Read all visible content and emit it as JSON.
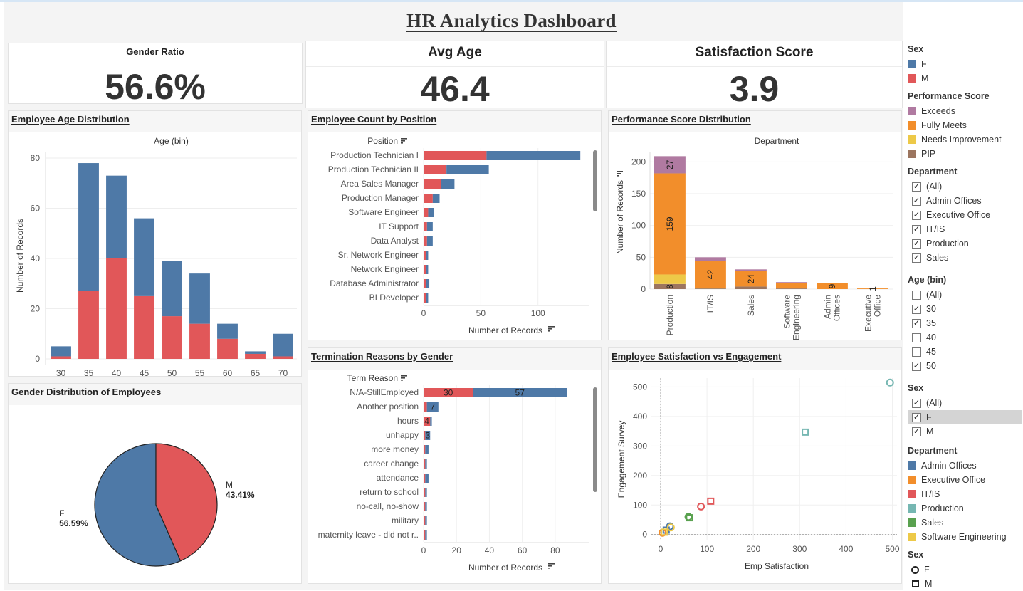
{
  "title": "HR Analytics Dashboard",
  "kpis": {
    "gender_ratio": {
      "label": "Gender Ratio",
      "value": "56.6%"
    },
    "avg_age": {
      "label": "Avg Age",
      "value": "46.4"
    },
    "satisfaction": {
      "label": "Satisfaction Score",
      "value": "3.9"
    }
  },
  "colors": {
    "F": "#4e79a7",
    "M": "#e15759",
    "Exceeds": "#b07aa1",
    "Fully Meets": "#f28e2b",
    "Needs Improvement": "#edc948",
    "PIP": "#9c755f",
    "Admin Offices": "#4e79a7",
    "Executive Office": "#f28e2b",
    "IT/IS": "#e15759",
    "Production": "#76b7b2",
    "Sales": "#59a14f",
    "Software Engineering": "#edc948"
  },
  "panels": {
    "age": {
      "title": "Employee Age Distribution",
      "header": "Age (bin)",
      "ylabel": "Number of Records"
    },
    "position": {
      "title": "Employee Count by Position",
      "header": "Position",
      "xlabel": "Number of Records"
    },
    "performance": {
      "title": "Performance Score Distribution",
      "header": "Department",
      "ylabel": "Number of Records"
    },
    "gender": {
      "title": "Gender Distribution of Employees"
    },
    "termination": {
      "title": "Termination Reasons by Gender",
      "header": "Term Reason",
      "xlabel": "Number of Records"
    },
    "satisfaction": {
      "title": "Employee Satisfaction vs Engagement",
      "xlabel": "Emp Satisfaction",
      "ylabel": "Engagement Survey"
    }
  },
  "chart_data": [
    {
      "id": "age",
      "type": "bar",
      "title": "Employee Age Distribution",
      "xlabel": "Age (bin)",
      "ylabel": "Number of Records",
      "categories": [
        "30",
        "35",
        "40",
        "45",
        "50",
        "55",
        "60",
        "65",
        "70"
      ],
      "series": [
        {
          "name": "M",
          "values": [
            1,
            27,
            40,
            25,
            17,
            14,
            8,
            2,
            1
          ]
        },
        {
          "name": "F",
          "values": [
            4,
            51,
            33,
            31,
            22,
            20,
            6,
            1,
            9
          ]
        }
      ],
      "stacked": true,
      "ylim": [
        0,
        80
      ],
      "yticks": [
        0,
        20,
        40,
        60,
        80
      ]
    },
    {
      "id": "position",
      "type": "bar",
      "orientation": "horizontal",
      "title": "Employee Count by Position",
      "ylabel": "Position",
      "xlabel": "Number of Records",
      "categories": [
        "Production Technician I",
        "Production Technician II",
        "Area Sales Manager",
        "Production Manager",
        "Software Engineer",
        "IT Support",
        "Data Analyst",
        "Sr. Network Engineer",
        "Network Engineer",
        "Database Administrator",
        "BI Developer"
      ],
      "series": [
        {
          "name": "M",
          "values": [
            55,
            20,
            15,
            8,
            4,
            3,
            3,
            2,
            2,
            2,
            2
          ]
        },
        {
          "name": "F",
          "values": [
            82,
            37,
            12,
            6,
            5,
            5,
            5,
            2,
            2,
            3,
            2
          ]
        }
      ],
      "stacked": true,
      "xlim": [
        0,
        140
      ],
      "xticks": [
        0,
        50,
        100
      ]
    },
    {
      "id": "performance",
      "type": "bar",
      "title": "Performance Score Distribution",
      "xlabel": "Department",
      "ylabel": "Number of Records",
      "categories": [
        "Production",
        "IT/IS",
        "Sales",
        "Software Engineering",
        "Admin Offices",
        "Executive Office"
      ],
      "series": [
        {
          "name": "PIP",
          "values": [
            8,
            1,
            4,
            1,
            0,
            0
          ]
        },
        {
          "name": "Needs Improvement",
          "values": [
            15,
            1,
            0,
            0,
            0,
            0
          ]
        },
        {
          "name": "Fully Meets",
          "values": [
            159,
            42,
            24,
            9,
            9,
            1
          ]
        },
        {
          "name": "Exceeds",
          "values": [
            27,
            6,
            3,
            1,
            0,
            0
          ]
        }
      ],
      "labels": {
        "PIP": [
          8,
          null,
          null,
          null,
          null,
          null
        ],
        "Fully Meets": [
          159,
          42,
          24,
          null,
          9,
          1
        ],
        "Exceeds": [
          27,
          null,
          null,
          null,
          null,
          null
        ]
      },
      "stacked": true,
      "ylim": [
        0,
        215
      ],
      "yticks": [
        0,
        50,
        100,
        150,
        200
      ]
    },
    {
      "id": "gender",
      "type": "pie",
      "title": "Gender Distribution of Employees",
      "slices": [
        {
          "name": "F",
          "value": 56.59,
          "label": "56.59%"
        },
        {
          "name": "M",
          "value": 43.41,
          "label": "43.41%"
        }
      ]
    },
    {
      "id": "termination",
      "type": "bar",
      "orientation": "horizontal",
      "title": "Termination Reasons by Gender",
      "ylabel": "Term Reason",
      "xlabel": "Number of Records",
      "categories": [
        "N/A-StillEmployed",
        "Another position",
        "hours",
        "unhappy",
        "more money",
        "career change",
        "attendance",
        "return to school",
        "no-call, no-show",
        "military",
        "maternity leave - did not r.."
      ],
      "series": [
        {
          "name": "M",
          "values": [
            30,
            2,
            4,
            1,
            1,
            1,
            1,
            1,
            1,
            1,
            1
          ]
        },
        {
          "name": "F",
          "values": [
            57,
            7,
            1,
            3,
            2,
            1,
            2,
            1,
            1,
            1,
            1
          ]
        }
      ],
      "labels": {
        "M": [
          30,
          null,
          4,
          null,
          null,
          null,
          null,
          null,
          null,
          null,
          null
        ],
        "F": [
          57,
          7,
          null,
          3,
          null,
          null,
          null,
          null,
          null,
          null,
          null
        ]
      },
      "stacked": true,
      "xlim": [
        0,
        90
      ],
      "xticks": [
        0,
        20,
        40,
        60,
        80
      ]
    },
    {
      "id": "satisfaction",
      "type": "scatter",
      "title": "Employee Satisfaction vs Engagement",
      "xlabel": "Emp Satisfaction",
      "ylabel": "Engagement Survey",
      "xlim": [
        -20,
        510
      ],
      "ylim": [
        -20,
        530
      ],
      "xticks": [
        0,
        100,
        200,
        300,
        400,
        500
      ],
      "yticks": [
        0,
        100,
        200,
        300,
        400,
        500
      ],
      "points": [
        {
          "x": 495,
          "y": 515,
          "dept": "Production",
          "sex": "F"
        },
        {
          "x": 312,
          "y": 347,
          "dept": "Production",
          "sex": "M"
        },
        {
          "x": 108,
          "y": 113,
          "dept": "IT/IS",
          "sex": "M"
        },
        {
          "x": 87,
          "y": 95,
          "dept": "IT/IS",
          "sex": "F"
        },
        {
          "x": 60,
          "y": 60,
          "dept": "Sales",
          "sex": "F"
        },
        {
          "x": 62,
          "y": 57,
          "dept": "Sales",
          "sex": "M"
        },
        {
          "x": 20,
          "y": 28,
          "dept": "Admin Offices",
          "sex": "F"
        },
        {
          "x": 12,
          "y": 15,
          "dept": "Admin Offices",
          "sex": "M"
        },
        {
          "x": 22,
          "y": 24,
          "dept": "Software Engineering",
          "sex": "F"
        },
        {
          "x": 4,
          "y": 6,
          "dept": "Executive Office",
          "sex": "F"
        },
        {
          "x": 8,
          "y": 8,
          "dept": "Software Engineering",
          "sex": "M"
        }
      ]
    }
  ],
  "legend": {
    "sex_title": "Sex",
    "sex_items": [
      "F",
      "M"
    ],
    "perf_title": "Performance Score",
    "perf_items": [
      "Exceeds",
      "Fully Meets",
      "Needs Improvement",
      "PIP"
    ],
    "dept_filter_title": "Department",
    "dept_filter_items": [
      {
        "label": "(All)",
        "checked": true
      },
      {
        "label": "Admin Offices",
        "checked": true
      },
      {
        "label": "Executive Office",
        "checked": true
      },
      {
        "label": "IT/IS",
        "checked": true
      },
      {
        "label": "Production",
        "checked": true
      },
      {
        "label": "Sales",
        "checked": true
      }
    ],
    "age_filter_title": "Age (bin)",
    "age_filter_items": [
      {
        "label": "(All)",
        "checked": false
      },
      {
        "label": "30",
        "checked": true
      },
      {
        "label": "35",
        "checked": true
      },
      {
        "label": "40",
        "checked": false
      },
      {
        "label": "45",
        "checked": false
      },
      {
        "label": "50",
        "checked": true
      }
    ],
    "sex_filter_title": "Sex",
    "sex_filter_items": [
      {
        "label": "(All)",
        "checked": true
      },
      {
        "label": "F",
        "checked": true,
        "selected": true
      },
      {
        "label": "M",
        "checked": true
      }
    ],
    "dept_color_title": "Department",
    "dept_color_items": [
      "Admin Offices",
      "Executive Office",
      "IT/IS",
      "Production",
      "Sales",
      "Software Engineering"
    ],
    "sex_shape_title": "Sex",
    "sex_shape_items": [
      {
        "label": "F",
        "shape": "circle"
      },
      {
        "label": "M",
        "shape": "square"
      }
    ]
  }
}
